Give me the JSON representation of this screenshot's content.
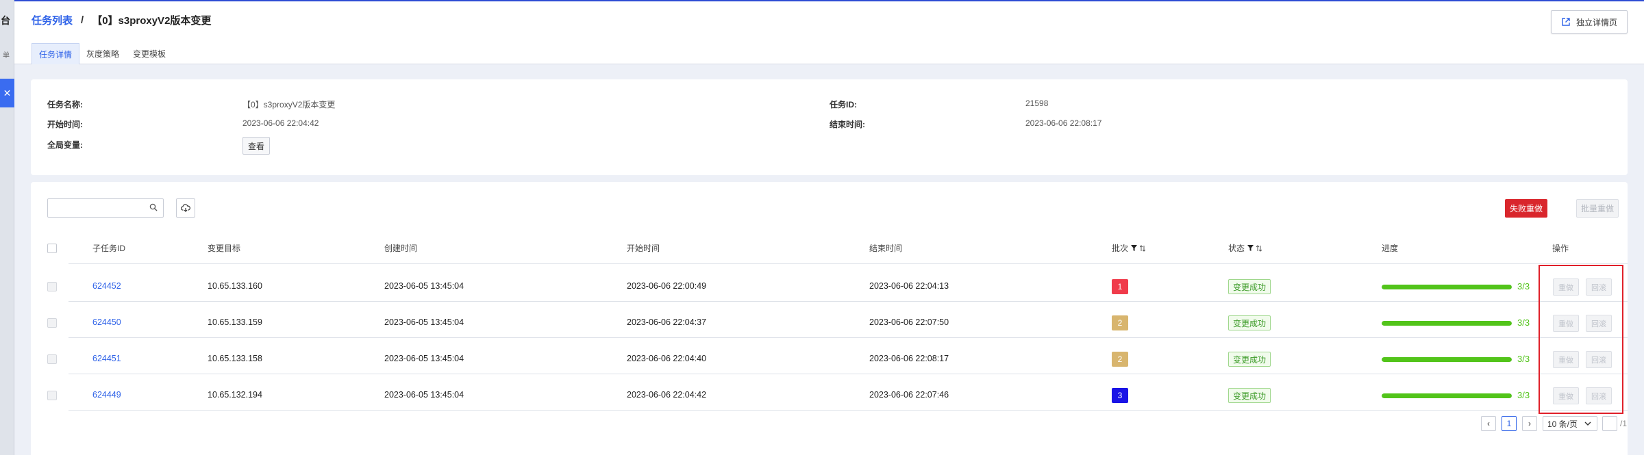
{
  "sidebar": {
    "char1": "台",
    "char2": "单",
    "close_glyph": "✕"
  },
  "header": {
    "breadcrumb_link": "任务列表",
    "breadcrumb_sep": "/",
    "breadcrumb_current": "【0】s3proxyV2版本变更",
    "detail_button": "独立详情页",
    "tabs": [
      "任务详情",
      "灰度策略",
      "变更模板"
    ]
  },
  "info": {
    "name_label": "任务名称:",
    "name_value": "【0】s3proxyV2版本变更",
    "id_label": "任务ID:",
    "id_value": "21598",
    "start_label": "开始时间:",
    "start_value": "2023-06-06 22:04:42",
    "end_label": "结束时间:",
    "end_value": "2023-06-06 22:08:17",
    "vars_label": "全局变量:",
    "view_button": "查看"
  },
  "toolbar": {
    "search_placeholder": "",
    "fail_retry": "失败重做",
    "batch_retry": "批量重做"
  },
  "table": {
    "columns": [
      "子任务ID",
      "变更目标",
      "创建时间",
      "开始时间",
      "结束时间",
      "批次",
      "状态",
      "进度",
      "操作"
    ],
    "rows": [
      {
        "id": "624452",
        "target": "10.65.133.160",
        "created": "2023-06-05 13:45:04",
        "start": "2023-06-06 22:00:49",
        "end": "2023-06-06 22:04:13",
        "batch": "1",
        "batch_color": "#f03b4b",
        "status": "变更成功",
        "progress": 1.0,
        "progress_text": "3/3",
        "op1": "重做",
        "op2": "回滚"
      },
      {
        "id": "624450",
        "target": "10.65.133.159",
        "created": "2023-06-05 13:45:04",
        "start": "2023-06-06 22:04:37",
        "end": "2023-06-06 22:07:50",
        "batch": "2",
        "batch_color": "#d8b56e",
        "status": "变更成功",
        "progress": 1.0,
        "progress_text": "3/3",
        "op1": "重做",
        "op2": "回滚"
      },
      {
        "id": "624451",
        "target": "10.65.133.158",
        "created": "2023-06-05 13:45:04",
        "start": "2023-06-06 22:04:40",
        "end": "2023-06-06 22:08:17",
        "batch": "2",
        "batch_color": "#d8b56e",
        "status": "变更成功",
        "progress": 1.0,
        "progress_text": "3/3",
        "op1": "重做",
        "op2": "回滚"
      },
      {
        "id": "624449",
        "target": "10.65.132.194",
        "created": "2023-06-05 13:45:04",
        "start": "2023-06-06 22:04:42",
        "end": "2023-06-06 22:07:46",
        "batch": "3",
        "batch_color": "#1a14e6",
        "status": "变更成功",
        "progress": 1.0,
        "progress_text": "3/3",
        "op1": "重做",
        "op2": "回滚"
      }
    ]
  },
  "pagination": {
    "prev": "‹",
    "current_page": "1",
    "next": "›",
    "page_size": "10 条/页",
    "total": "/1"
  }
}
